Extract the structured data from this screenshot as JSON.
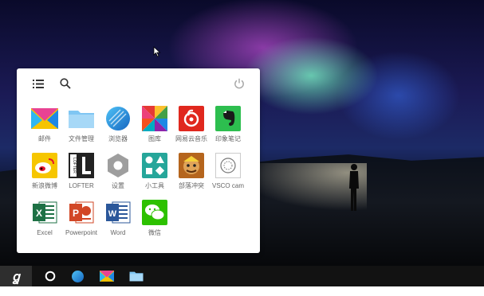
{
  "desktop": {
    "wallpaper": "aurora-night-sky"
  },
  "start_menu": {
    "header": {
      "list_icon": "list-icon",
      "search_icon": "search-icon",
      "power_icon": "power-icon"
    },
    "apps": [
      {
        "label": "邮件",
        "icon": "mail-icon"
      },
      {
        "label": "文件管理",
        "icon": "folder-icon"
      },
      {
        "label": "浏览器",
        "icon": "browser-icon"
      },
      {
        "label": "图库",
        "icon": "gallery-icon"
      },
      {
        "label": "网易云音乐",
        "icon": "netease-music-icon"
      },
      {
        "label": "印象笔记",
        "icon": "evernote-icon"
      },
      {
        "label": "新浪微博",
        "icon": "weibo-icon"
      },
      {
        "label": "LOFTER",
        "icon": "lofter-icon"
      },
      {
        "label": "设置",
        "icon": "settings-icon"
      },
      {
        "label": "小工具",
        "icon": "widgets-icon"
      },
      {
        "label": "部落冲突",
        "icon": "clash-of-clans-icon"
      },
      {
        "label": "VSCO cam",
        "icon": "vsco-icon"
      },
      {
        "label": "Excel",
        "icon": "excel-icon"
      },
      {
        "label": "Powerpoint",
        "icon": "powerpoint-icon"
      },
      {
        "label": "Word",
        "icon": "word-icon"
      },
      {
        "label": "微信",
        "icon": "wechat-icon"
      }
    ]
  },
  "taskbar": {
    "start_glyph": "ꬶ",
    "items": [
      "home-circle-icon",
      "browser-icon",
      "mail-icon",
      "folder-icon"
    ]
  },
  "colors": {
    "taskbar": "#121212",
    "start_button": "#2e2e2e",
    "panel": "#ffffff",
    "label": "#666666"
  }
}
